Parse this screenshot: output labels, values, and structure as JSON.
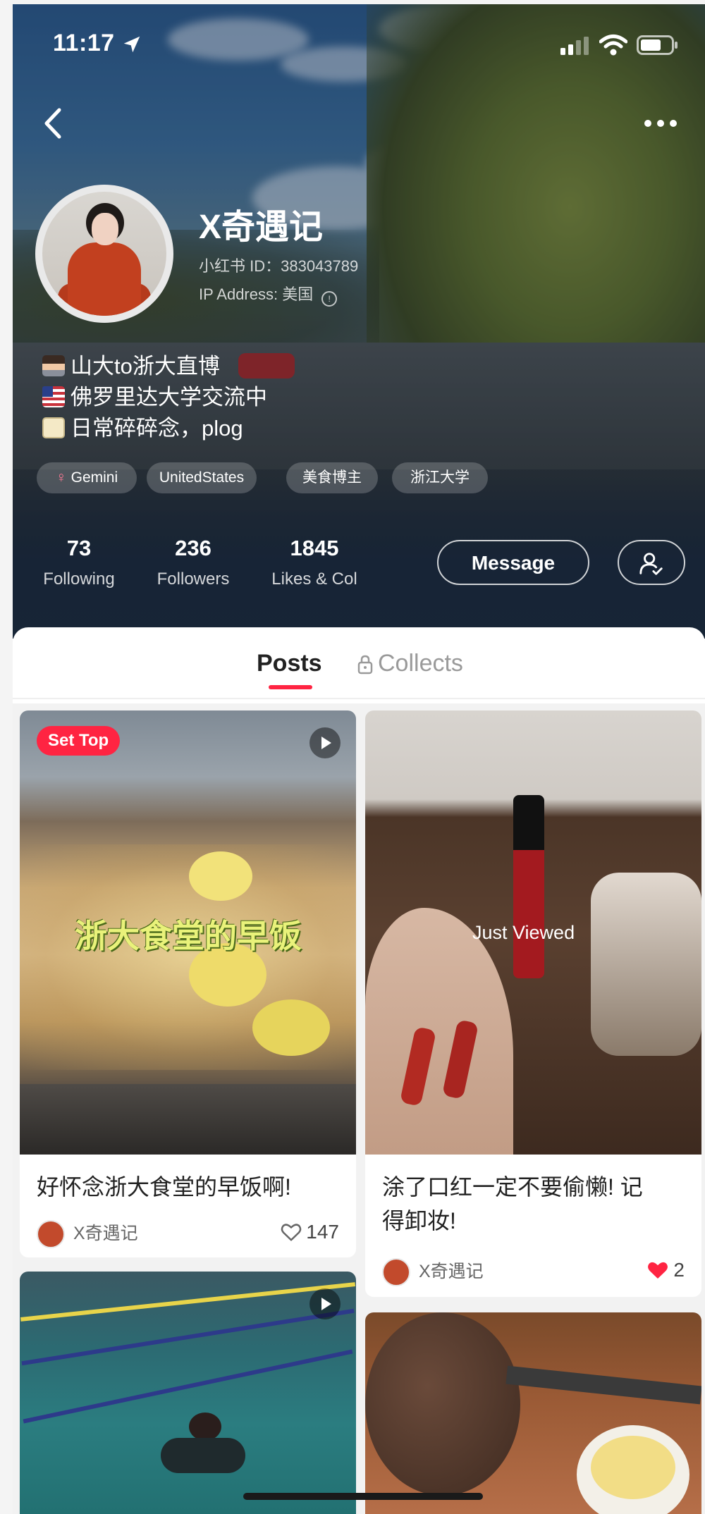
{
  "status_bar": {
    "time": "11:17"
  },
  "profile": {
    "nickname": "X奇遇记",
    "user_id": "小红书 ID：383043789",
    "ip_address": "IP Address: 美国",
    "bio": [
      "山大to浙大直博",
      "佛罗里达大学交流中",
      "日常碎碎念，plog"
    ],
    "tags": [
      "Gemini",
      "UnitedStates",
      "美食博主",
      "浙江大学"
    ],
    "stats": [
      {
        "value": "73",
        "label": "Following"
      },
      {
        "value": "236",
        "label": "Followers"
      },
      {
        "value": "1845",
        "label": "Likes & Col"
      }
    ],
    "message_label": "Message"
  },
  "tabs": {
    "posts": "Posts",
    "collects": "Collects"
  },
  "posts": [
    {
      "badge": "Set Top",
      "overlay": "浙大食堂的早饭",
      "title": "好怀念浙大食堂的早饭啊!",
      "author": "X奇遇记",
      "likes": "147",
      "liked": false
    },
    {
      "overlay": "Just Viewed",
      "title_lines": [
        "涂了口红一定不要偷懒! 记",
        "得卸妆!"
      ],
      "author": "X奇遇记",
      "likes": "2",
      "liked": true
    }
  ],
  "colors": {
    "accent": "#ff2442"
  }
}
